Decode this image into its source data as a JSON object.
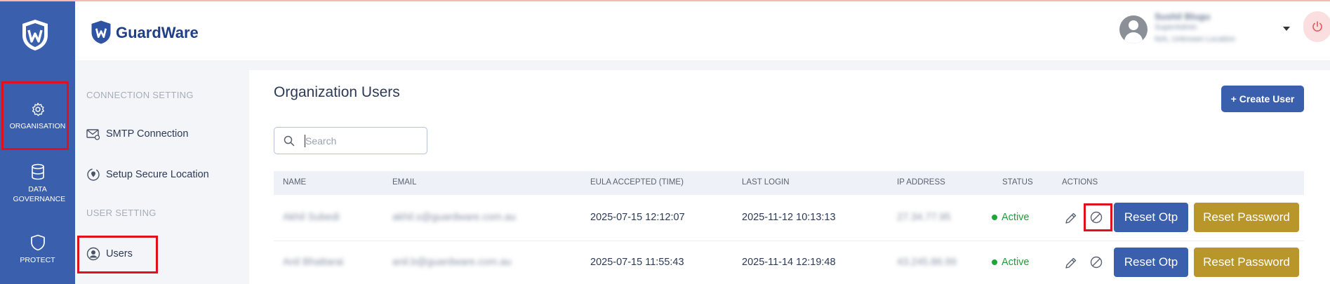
{
  "rail": {
    "items": [
      {
        "label": "ORGANISATION",
        "icon": "gear-icon"
      },
      {
        "label": "DATA GOVERNANCE",
        "icon": "database-icon"
      },
      {
        "label": "PROTECT",
        "icon": "shield-icon"
      }
    ]
  },
  "brand": {
    "name": "GuardWare"
  },
  "sidebar": {
    "sections": [
      {
        "title": "CONNECTION SETTING",
        "items": [
          {
            "label": "SMTP Connection",
            "icon": "mail-settings-icon"
          },
          {
            "label": "Setup Secure Location",
            "icon": "location-sync-icon"
          }
        ]
      },
      {
        "title": "USER SETTING",
        "items": [
          {
            "label": "Users",
            "icon": "user-circle-icon"
          }
        ]
      }
    ]
  },
  "header": {
    "user_name": "Sushil Blugu",
    "user_role": "SuperAdmin",
    "user_location": "N/A, Unknown Location",
    "avatar_icon": "avatar-icon",
    "logout_icon": "power-icon"
  },
  "main": {
    "title": "Organization Users",
    "create_label": "+ Create User",
    "search_placeholder": "Search"
  },
  "table": {
    "columns": [
      "NAME",
      "EMAIL",
      "EULA ACCEPTED (TIME)",
      "LAST LOGIN",
      "IP ADDRESS",
      "STATUS",
      "ACTIONS"
    ],
    "rows": [
      {
        "name": "Akhil Subedi",
        "email": "akhil.s@guardware.com.au",
        "eula": "2025-07-15 12:12:07",
        "last_login": "2025-11-12 10:13:13",
        "ip": "27.34.77.95",
        "status": "Active",
        "reset_otp": "Reset Otp",
        "reset_password": "Reset Password"
      },
      {
        "name": "Anil Bhattarai",
        "email": "anil.b@guardware.com.au",
        "eula": "2025-07-15 11:55:43",
        "last_login": "2025-11-14 12:19:48",
        "ip": "43.245.86.99",
        "status": "Active",
        "reset_otp": "Reset Otp",
        "reset_password": "Reset Password"
      }
    ]
  },
  "colors": {
    "primary": "#3a60ad",
    "gold": "#b8962a",
    "active": "#1f9d3a",
    "highlight": "#e0101e"
  }
}
